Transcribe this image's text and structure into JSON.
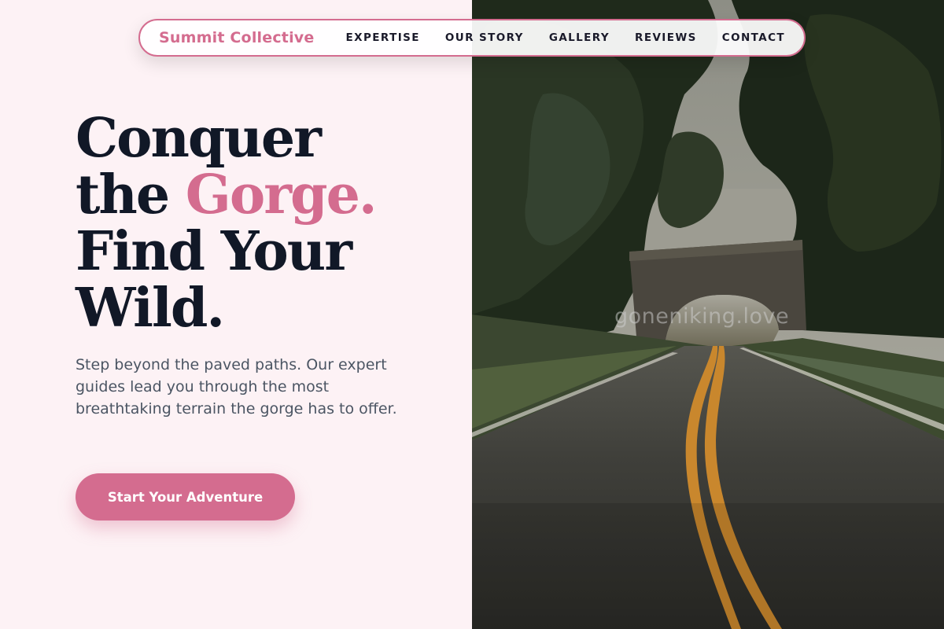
{
  "nav": {
    "brand": "Summit Collective",
    "links": [
      "EXPERTISE",
      "OUR STORY",
      "GALLERY",
      "REVIEWS",
      "CONTACT"
    ]
  },
  "hero": {
    "line1": "Conquer",
    "line2_prefix": "the ",
    "line2_accent": "Gorge.",
    "line3": "Find Your",
    "line4": "Wild.",
    "subtitle": "Step beyond the paved paths. Our expert guides lead you through the most breathtaking terrain the gorge has to offer.",
    "cta_label": "Start Your Adventure"
  },
  "image": {
    "watermark": "goneniking.love",
    "subject": "road-under-stone-bridge-photo"
  },
  "colors": {
    "accent": "#d46c8f",
    "background": "#fdf2f5",
    "heading": "#111827",
    "body_text": "#4b5563"
  }
}
